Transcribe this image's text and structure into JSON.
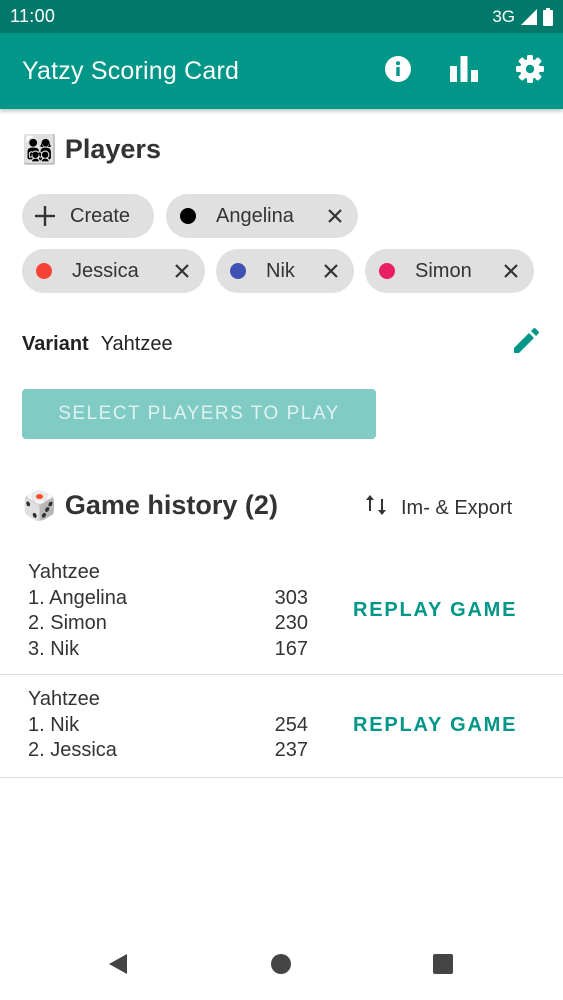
{
  "status_bar": {
    "time": "11:00",
    "network": "3G"
  },
  "app_bar": {
    "title": "Yatzy Scoring Card",
    "actions": [
      "info-icon",
      "bar-chart-icon",
      "settings-icon"
    ]
  },
  "players_section": {
    "emoji": "👨‍👩‍👧‍👦",
    "title": "Players",
    "create_label": "Create",
    "players": [
      {
        "name": "Angelina",
        "color": "#000000"
      },
      {
        "name": "Jessica",
        "color": "#f44336"
      },
      {
        "name": "Nik",
        "color": "#3f51b5"
      },
      {
        "name": "Simon",
        "color": "#e91e63"
      }
    ]
  },
  "variant": {
    "label": "Variant",
    "value": "Yahtzee"
  },
  "play_button": {
    "label": "SELECT PLAYERS TO PLAY"
  },
  "history_section": {
    "emoji": "🎲",
    "title": "Game history (2)",
    "export_label": "Im- & Export",
    "games": [
      {
        "variant": "Yahtzee",
        "results": [
          {
            "rank_name": "1. Angelina",
            "score": "303"
          },
          {
            "rank_name": "2. Simon",
            "score": "230"
          },
          {
            "rank_name": "3. Nik",
            "score": "167"
          }
        ],
        "replay_label": "REPLAY GAME"
      },
      {
        "variant": "Yahtzee",
        "results": [
          {
            "rank_name": "1. Nik",
            "score": "254"
          },
          {
            "rank_name": "2. Jessica",
            "score": "237"
          }
        ],
        "replay_label": "REPLAY GAME"
      }
    ]
  },
  "colors": {
    "primary": "#009688",
    "primary_dark": "#00796b",
    "disabled_button": "#80cbc4"
  }
}
